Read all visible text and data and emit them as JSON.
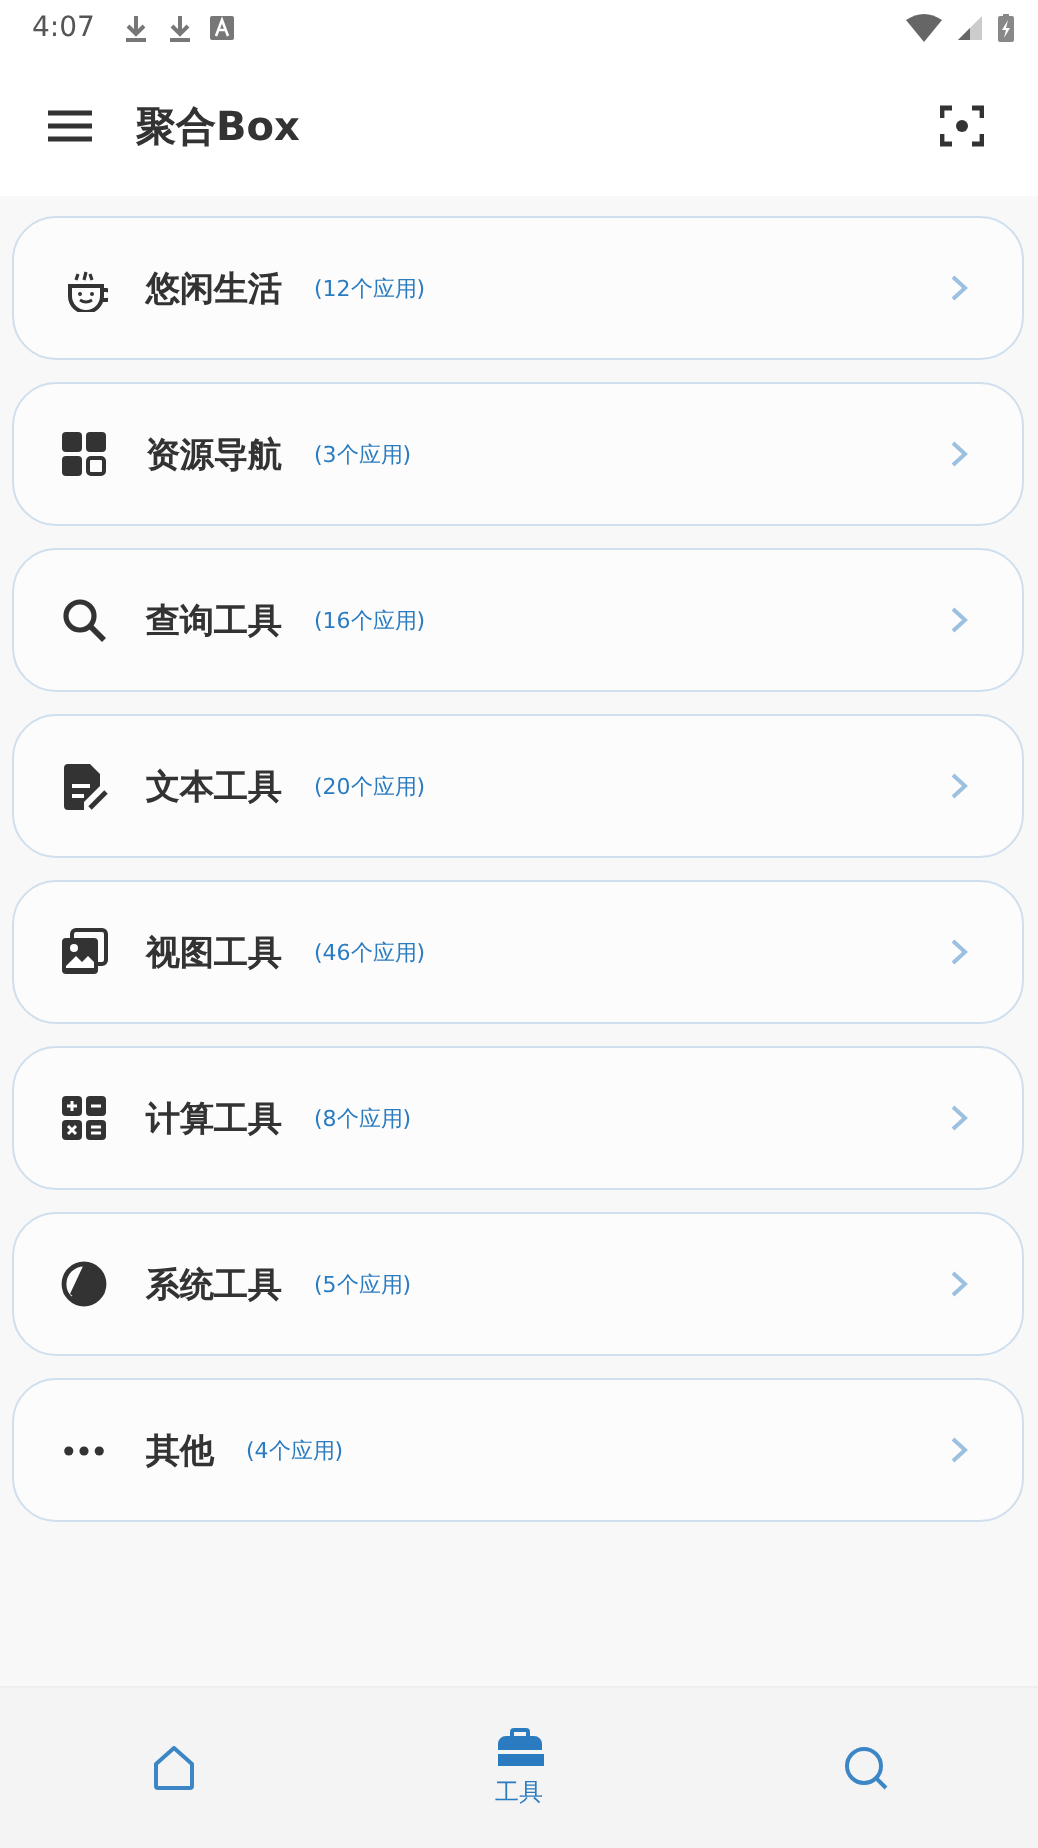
{
  "status_bar": {
    "time": "4:07"
  },
  "app_bar": {
    "title": "聚合Box"
  },
  "categories": [
    {
      "kind": "cup",
      "name": "悠闲生活",
      "count": "(12个应用)"
    },
    {
      "kind": "grid",
      "name": "资源导航",
      "count": "(3个应用)"
    },
    {
      "kind": "search",
      "name": "查询工具",
      "count": "(16个应用)"
    },
    {
      "kind": "document",
      "name": "文本工具",
      "count": "(20个应用)"
    },
    {
      "kind": "image",
      "name": "视图工具",
      "count": "(46个应用)"
    },
    {
      "kind": "calculator",
      "name": "计算工具",
      "count": "(8个应用)"
    },
    {
      "kind": "contrast",
      "name": "系统工具",
      "count": "(5个应用)"
    },
    {
      "kind": "dots",
      "name": "其他",
      "count": "(4个应用)"
    }
  ],
  "bottom_nav": [
    {
      "kind": "home",
      "selected": false
    },
    {
      "kind": "toolbox",
      "label": "工具",
      "selected": true
    },
    {
      "kind": "search",
      "selected": false
    }
  ]
}
